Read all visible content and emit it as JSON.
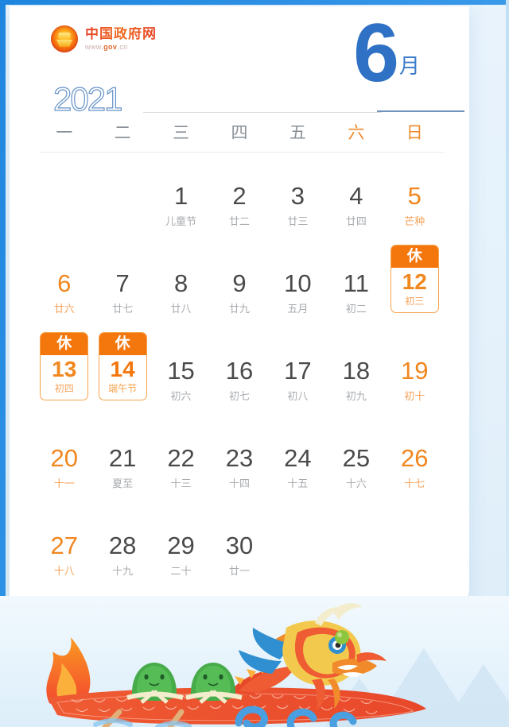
{
  "brand": {
    "emblem_icon": "national-emblem-icon",
    "name": "中国政府网",
    "url_prefix": "www.",
    "url_mid": "gov",
    "url_suffix": ".cn"
  },
  "header": {
    "year": "2021",
    "month_number": "6",
    "month_unit": "月"
  },
  "colors": {
    "accent_blue": "#2f71c4",
    "accent_orange": "#f4770e",
    "weekend_orange": "#f0871f",
    "text_gray": "#4a4a4a",
    "sub_gray": "#a8abaf"
  },
  "weekdays": [
    {
      "label": "一",
      "weekend": false
    },
    {
      "label": "二",
      "weekend": false
    },
    {
      "label": "三",
      "weekend": false
    },
    {
      "label": "四",
      "weekend": false
    },
    {
      "label": "五",
      "weekend": false
    },
    {
      "label": "六",
      "weekend": true
    },
    {
      "label": "日",
      "weekend": true
    }
  ],
  "rest_label": "休",
  "days": [
    {
      "num": "",
      "sub": "",
      "blank": true
    },
    {
      "num": "",
      "sub": "",
      "blank": true
    },
    {
      "num": "1",
      "sub": "儿童节",
      "weekend": false,
      "rest": false
    },
    {
      "num": "2",
      "sub": "廿二",
      "weekend": false,
      "rest": false
    },
    {
      "num": "3",
      "sub": "廿三",
      "weekend": false,
      "rest": false
    },
    {
      "num": "4",
      "sub": "廿四",
      "weekend": false,
      "rest": false
    },
    {
      "num": "5",
      "sub": "芒种",
      "weekend": true,
      "rest": false
    },
    {
      "num": "6",
      "sub": "廿六",
      "weekend": true,
      "rest": false
    },
    {
      "num": "7",
      "sub": "廿七",
      "weekend": false,
      "rest": false
    },
    {
      "num": "8",
      "sub": "廿八",
      "weekend": false,
      "rest": false
    },
    {
      "num": "9",
      "sub": "廿九",
      "weekend": false,
      "rest": false
    },
    {
      "num": "10",
      "sub": "五月",
      "weekend": false,
      "rest": false
    },
    {
      "num": "11",
      "sub": "初二",
      "weekend": false,
      "rest": false
    },
    {
      "num": "12",
      "sub": "初三",
      "weekend": true,
      "rest": true
    },
    {
      "num": "13",
      "sub": "初四",
      "weekend": true,
      "rest": true
    },
    {
      "num": "14",
      "sub": "端午节",
      "weekend": false,
      "rest": true
    },
    {
      "num": "15",
      "sub": "初六",
      "weekend": false,
      "rest": false
    },
    {
      "num": "16",
      "sub": "初七",
      "weekend": false,
      "rest": false
    },
    {
      "num": "17",
      "sub": "初八",
      "weekend": false,
      "rest": false
    },
    {
      "num": "18",
      "sub": "初九",
      "weekend": false,
      "rest": false
    },
    {
      "num": "19",
      "sub": "初十",
      "weekend": true,
      "rest": false
    },
    {
      "num": "20",
      "sub": "十一",
      "weekend": true,
      "rest": false
    },
    {
      "num": "21",
      "sub": "夏至",
      "weekend": false,
      "rest": false
    },
    {
      "num": "22",
      "sub": "十三",
      "weekend": false,
      "rest": false
    },
    {
      "num": "23",
      "sub": "十四",
      "weekend": false,
      "rest": false
    },
    {
      "num": "24",
      "sub": "十五",
      "weekend": false,
      "rest": false
    },
    {
      "num": "25",
      "sub": "十六",
      "weekend": false,
      "rest": false
    },
    {
      "num": "26",
      "sub": "十七",
      "weekend": true,
      "rest": false
    },
    {
      "num": "27",
      "sub": "十八",
      "weekend": true,
      "rest": false
    },
    {
      "num": "28",
      "sub": "十九",
      "weekend": false,
      "rest": false
    },
    {
      "num": "29",
      "sub": "二十",
      "weekend": false,
      "rest": false
    },
    {
      "num": "30",
      "sub": "廿一",
      "weekend": false,
      "rest": false
    },
    {
      "num": "",
      "sub": "",
      "blank": true
    },
    {
      "num": "",
      "sub": "",
      "blank": true
    },
    {
      "num": "",
      "sub": "",
      "blank": true
    }
  ],
  "illustration": {
    "name": "dragon-boat-illustration",
    "elements": [
      "dragon-boat",
      "zongzi-characters",
      "blue-waves",
      "mountains",
      "flame-tail"
    ]
  }
}
